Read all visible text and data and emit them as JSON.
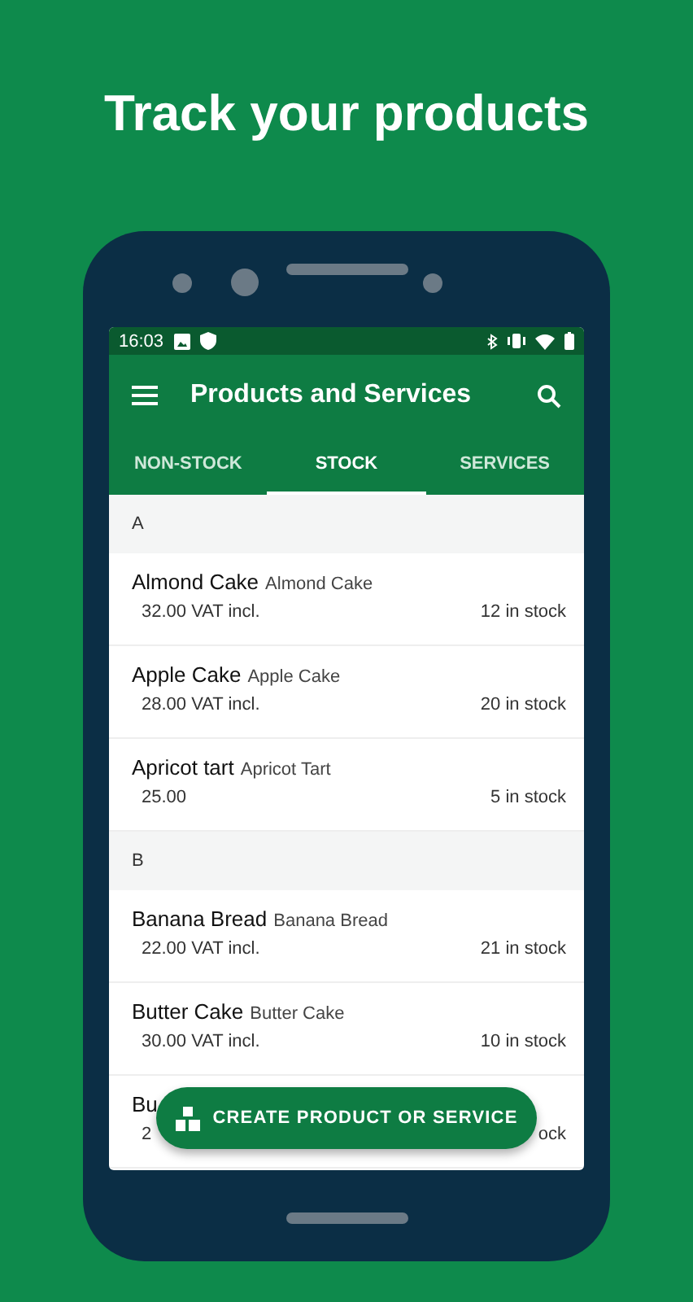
{
  "headline": "Track your products",
  "status_bar": {
    "time": "16:03"
  },
  "app_bar": {
    "title": "Products and Services"
  },
  "tabs": [
    {
      "label": "NON-STOCK",
      "selected": false
    },
    {
      "label": "STOCK",
      "selected": true
    },
    {
      "label": "SERVICES",
      "selected": false
    }
  ],
  "sections": [
    {
      "header": "A",
      "items": [
        {
          "name": "Almond Cake",
          "subtitle": "Almond Cake",
          "price": "32.00 VAT incl.",
          "stock": "12 in stock"
        },
        {
          "name": "Apple Cake",
          "subtitle": "Apple Cake",
          "price": "28.00 VAT incl.",
          "stock": "20 in stock"
        },
        {
          "name": "Apricot tart",
          "subtitle": "Apricot Tart",
          "price": "25.00",
          "stock": "5 in stock"
        }
      ]
    },
    {
      "header": "B",
      "items": [
        {
          "name": "Banana Bread",
          "subtitle": "Banana Bread",
          "price": "22.00 VAT incl.",
          "stock": "21 in stock"
        },
        {
          "name": "Butter Cake",
          "subtitle": "Butter Cake",
          "price": "30.00 VAT incl.",
          "stock": "10 in stock"
        },
        {
          "name": "Bu",
          "price": "2",
          "stock": "ock"
        }
      ]
    }
  ],
  "fab": {
    "label": "CREATE PRODUCT OR SERVICE"
  }
}
